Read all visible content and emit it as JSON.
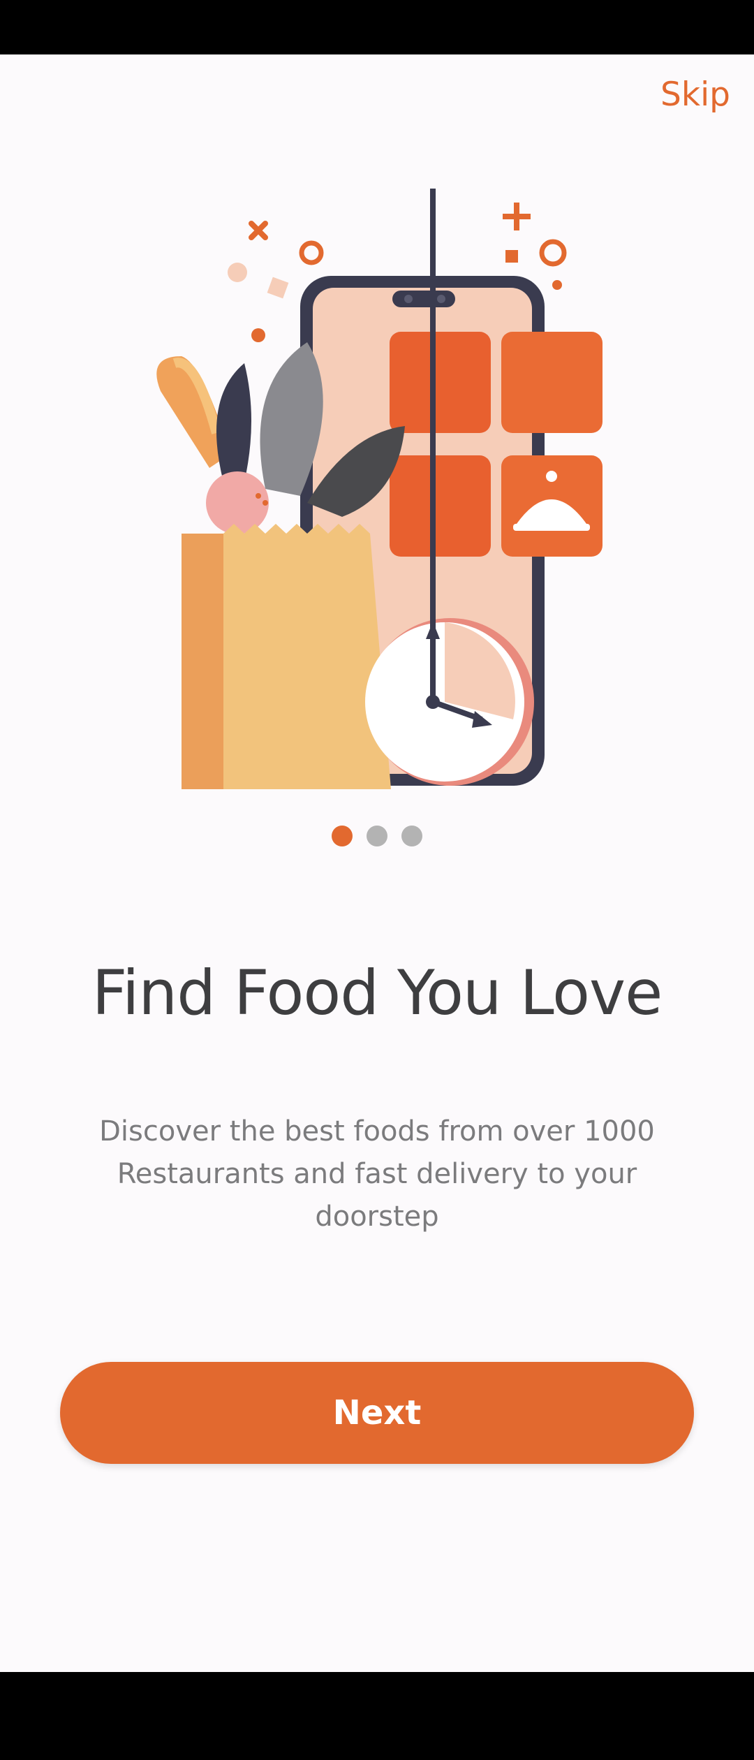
{
  "header": {
    "skip_label": "Skip"
  },
  "onboarding": {
    "title": "Find Food You Love",
    "description": "Discover the best foods from over 1000 Restaurants and fast delivery to your doorstep",
    "page_indicator": {
      "current": 1,
      "total": 3
    }
  },
  "actions": {
    "next_label": "Next"
  },
  "colors": {
    "accent": "#e2692f",
    "title": "#3e3e40",
    "body_text": "#7b7b7d",
    "background": "#fcfafc",
    "inactive_dot": "#b3b3b3"
  },
  "icons": [
    "food-bag-illustration",
    "phone-illustration",
    "cloche-icon",
    "clock-icon"
  ]
}
